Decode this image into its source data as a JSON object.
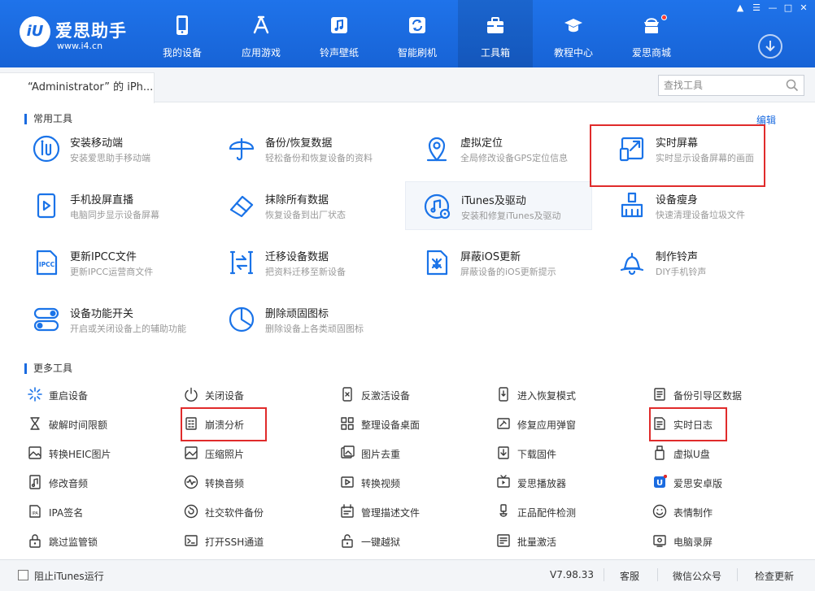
{
  "app": {
    "logo_badge": "iU",
    "name": "爱思助手",
    "url": "www.i4.cn"
  },
  "nav": [
    {
      "label": "我的设备",
      "icon": "phone-icon"
    },
    {
      "label": "应用游戏",
      "icon": "app-store-icon"
    },
    {
      "label": "铃声壁纸",
      "icon": "music-icon"
    },
    {
      "label": "智能刷机",
      "icon": "flash-icon"
    },
    {
      "label": "工具箱",
      "icon": "toolbox-icon"
    },
    {
      "label": "教程中心",
      "icon": "graduation-cap-icon"
    },
    {
      "label": "爱思商城",
      "icon": "shop-icon"
    }
  ],
  "active_nav": "工具箱",
  "tab": {
    "device_tab": "“Administrator” 的 iPh..."
  },
  "search": {
    "placeholder": "查找工具"
  },
  "sections": {
    "common": "常用工具",
    "more": "更多工具",
    "edit": "编辑"
  },
  "common_tools": [
    {
      "name": "安装移动端",
      "desc": "安装爱思助手移动端",
      "icon": "i4-app-icon"
    },
    {
      "name": "备份/恢复数据",
      "desc": "轻松备份和恢复设备的资料",
      "icon": "umbrella-icon"
    },
    {
      "name": "虚拟定位",
      "desc": "全局修改设备GPS定位信息",
      "icon": "location-pin-icon"
    },
    {
      "name": "实时屏幕",
      "desc": "实时显示设备屏幕的画面",
      "icon": "screen-mirror-icon"
    },
    {
      "name": "手机投屏直播",
      "desc": "电脑同步显示设备屏幕",
      "icon": "phone-cast-icon"
    },
    {
      "name": "抹除所有数据",
      "desc": "恢复设备到出厂状态",
      "icon": "eraser-icon"
    },
    {
      "name": "iTunes及驱动",
      "desc": "安装和修复iTunes及驱动",
      "icon": "itunes-gear-icon"
    },
    {
      "name": "设备瘦身",
      "desc": "快速清理设备垃圾文件",
      "icon": "broom-icon"
    },
    {
      "name": "更新IPCC文件",
      "desc": "更新IPCC运营商文件",
      "icon": "ipcc-file-icon"
    },
    {
      "name": "迁移设备数据",
      "desc": "把资料迁移至新设备",
      "icon": "migrate-icon"
    },
    {
      "name": "屏蔽iOS更新",
      "desc": "屏蔽设备的iOS更新提示",
      "icon": "block-update-icon"
    },
    {
      "name": "制作铃声",
      "desc": "DIY手机铃声",
      "icon": "bell-icon"
    },
    {
      "name": "设备功能开关",
      "desc": "开启或关闭设备上的辅助功能",
      "icon": "toggle-switch-icon"
    },
    {
      "name": "删除顽固图标",
      "desc": "删除设备上各类顽固图标",
      "icon": "pie-clock-icon"
    }
  ],
  "more_tools": [
    {
      "name": "重启设备",
      "icon": "restart-spinner-icon"
    },
    {
      "name": "关闭设备",
      "icon": "power-icon"
    },
    {
      "name": "反激活设备",
      "icon": "deactivate-icon"
    },
    {
      "name": "进入恢复模式",
      "icon": "recovery-mode-icon"
    },
    {
      "name": "备份引导区数据",
      "icon": "backup-boot-icon"
    },
    {
      "name": "破解时间限额",
      "icon": "hourglass-icon"
    },
    {
      "name": "崩溃分析",
      "icon": "crash-report-icon"
    },
    {
      "name": "整理设备桌面",
      "icon": "grid-icon"
    },
    {
      "name": "修复应用弹窗",
      "icon": "repair-popup-icon"
    },
    {
      "name": "实时日志",
      "icon": "log-file-icon"
    },
    {
      "name": "转换HEIC图片",
      "icon": "heic-image-icon"
    },
    {
      "name": "压缩照片",
      "icon": "compress-photo-icon"
    },
    {
      "name": "图片去重",
      "icon": "dedupe-image-icon"
    },
    {
      "name": "下载固件",
      "icon": "download-firmware-icon"
    },
    {
      "name": "虚拟U盘",
      "icon": "usb-drive-icon"
    },
    {
      "name": "修改音频",
      "icon": "edit-audio-icon"
    },
    {
      "name": "转换音频",
      "icon": "convert-audio-icon"
    },
    {
      "name": "转换视频",
      "icon": "convert-video-icon"
    },
    {
      "name": "爱思播放器",
      "icon": "tv-player-icon"
    },
    {
      "name": "爱思安卓版",
      "icon": "android-app-icon"
    },
    {
      "name": "IPA签名",
      "icon": "ipa-sign-icon"
    },
    {
      "name": "社交软件备份",
      "icon": "social-backup-icon"
    },
    {
      "name": "管理描述文件",
      "icon": "profile-manage-icon"
    },
    {
      "name": "正品配件检测",
      "icon": "accessory-check-icon"
    },
    {
      "name": "表情制作",
      "icon": "smiley-icon"
    },
    {
      "name": "跳过监管锁",
      "icon": "lock-skip-icon"
    },
    {
      "name": "打开SSH通道",
      "icon": "terminal-icon"
    },
    {
      "name": "一键越狱",
      "icon": "unlock-icon"
    },
    {
      "name": "批量激活",
      "icon": "batch-activate-icon"
    },
    {
      "name": "电脑录屏",
      "icon": "screen-record-icon"
    }
  ],
  "footer": {
    "block_itunes": "阻止iTunes运行",
    "version": "V7.98.33",
    "support": "客服",
    "wechat": "微信公众号",
    "check_update": "检查更新"
  },
  "colors": {
    "brand_blue": "#1a6be0",
    "highlight_red": "#e02b2b",
    "icon_blue": "#1a73e8"
  }
}
